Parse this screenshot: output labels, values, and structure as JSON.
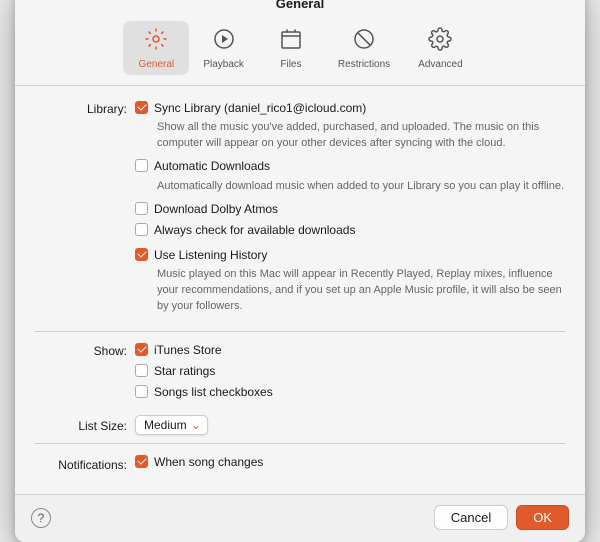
{
  "dialog": {
    "title": "General"
  },
  "toolbar": {
    "items": [
      {
        "id": "general",
        "label": "General",
        "active": true
      },
      {
        "id": "playback",
        "label": "Playback",
        "active": false
      },
      {
        "id": "files",
        "label": "Files",
        "active": false
      },
      {
        "id": "restrictions",
        "label": "Restrictions",
        "active": false
      },
      {
        "id": "advanced",
        "label": "Advanced",
        "active": false
      }
    ]
  },
  "library_section": {
    "label": "Library:",
    "sync_library": {
      "checked": true,
      "label": "Sync Library (daniel_rico1@icloud.com)",
      "helper": "Show all the music you've added, purchased, and uploaded. The music on this computer will appear on your other devices after syncing with the cloud."
    },
    "auto_downloads": {
      "checked": false,
      "label": "Automatic Downloads",
      "helper": "Automatically download music when added to your Library so you can play it offline."
    },
    "dolby_atmos": {
      "checked": false,
      "label": "Download Dolby Atmos"
    },
    "check_downloads": {
      "checked": false,
      "label": "Always check for available downloads"
    },
    "listening_history": {
      "checked": true,
      "label": "Use Listening History",
      "helper": "Music played on this Mac will appear in Recently Played, Replay mixes, influence your recommendations, and if you set up an Apple Music profile, it will also be seen by your followers."
    }
  },
  "show_section": {
    "label": "Show:",
    "itunes_store": {
      "checked": true,
      "label": "iTunes Store"
    },
    "star_ratings": {
      "checked": false,
      "label": "Star ratings"
    },
    "songs_checkboxes": {
      "checked": false,
      "label": "Songs list checkboxes"
    }
  },
  "list_size_section": {
    "label": "List Size:",
    "value": "Medium"
  },
  "notifications_section": {
    "label": "Notifications:",
    "when_song_changes": {
      "checked": true,
      "label": "When song changes"
    }
  },
  "footer": {
    "help_label": "?",
    "cancel_label": "Cancel",
    "ok_label": "OK"
  }
}
